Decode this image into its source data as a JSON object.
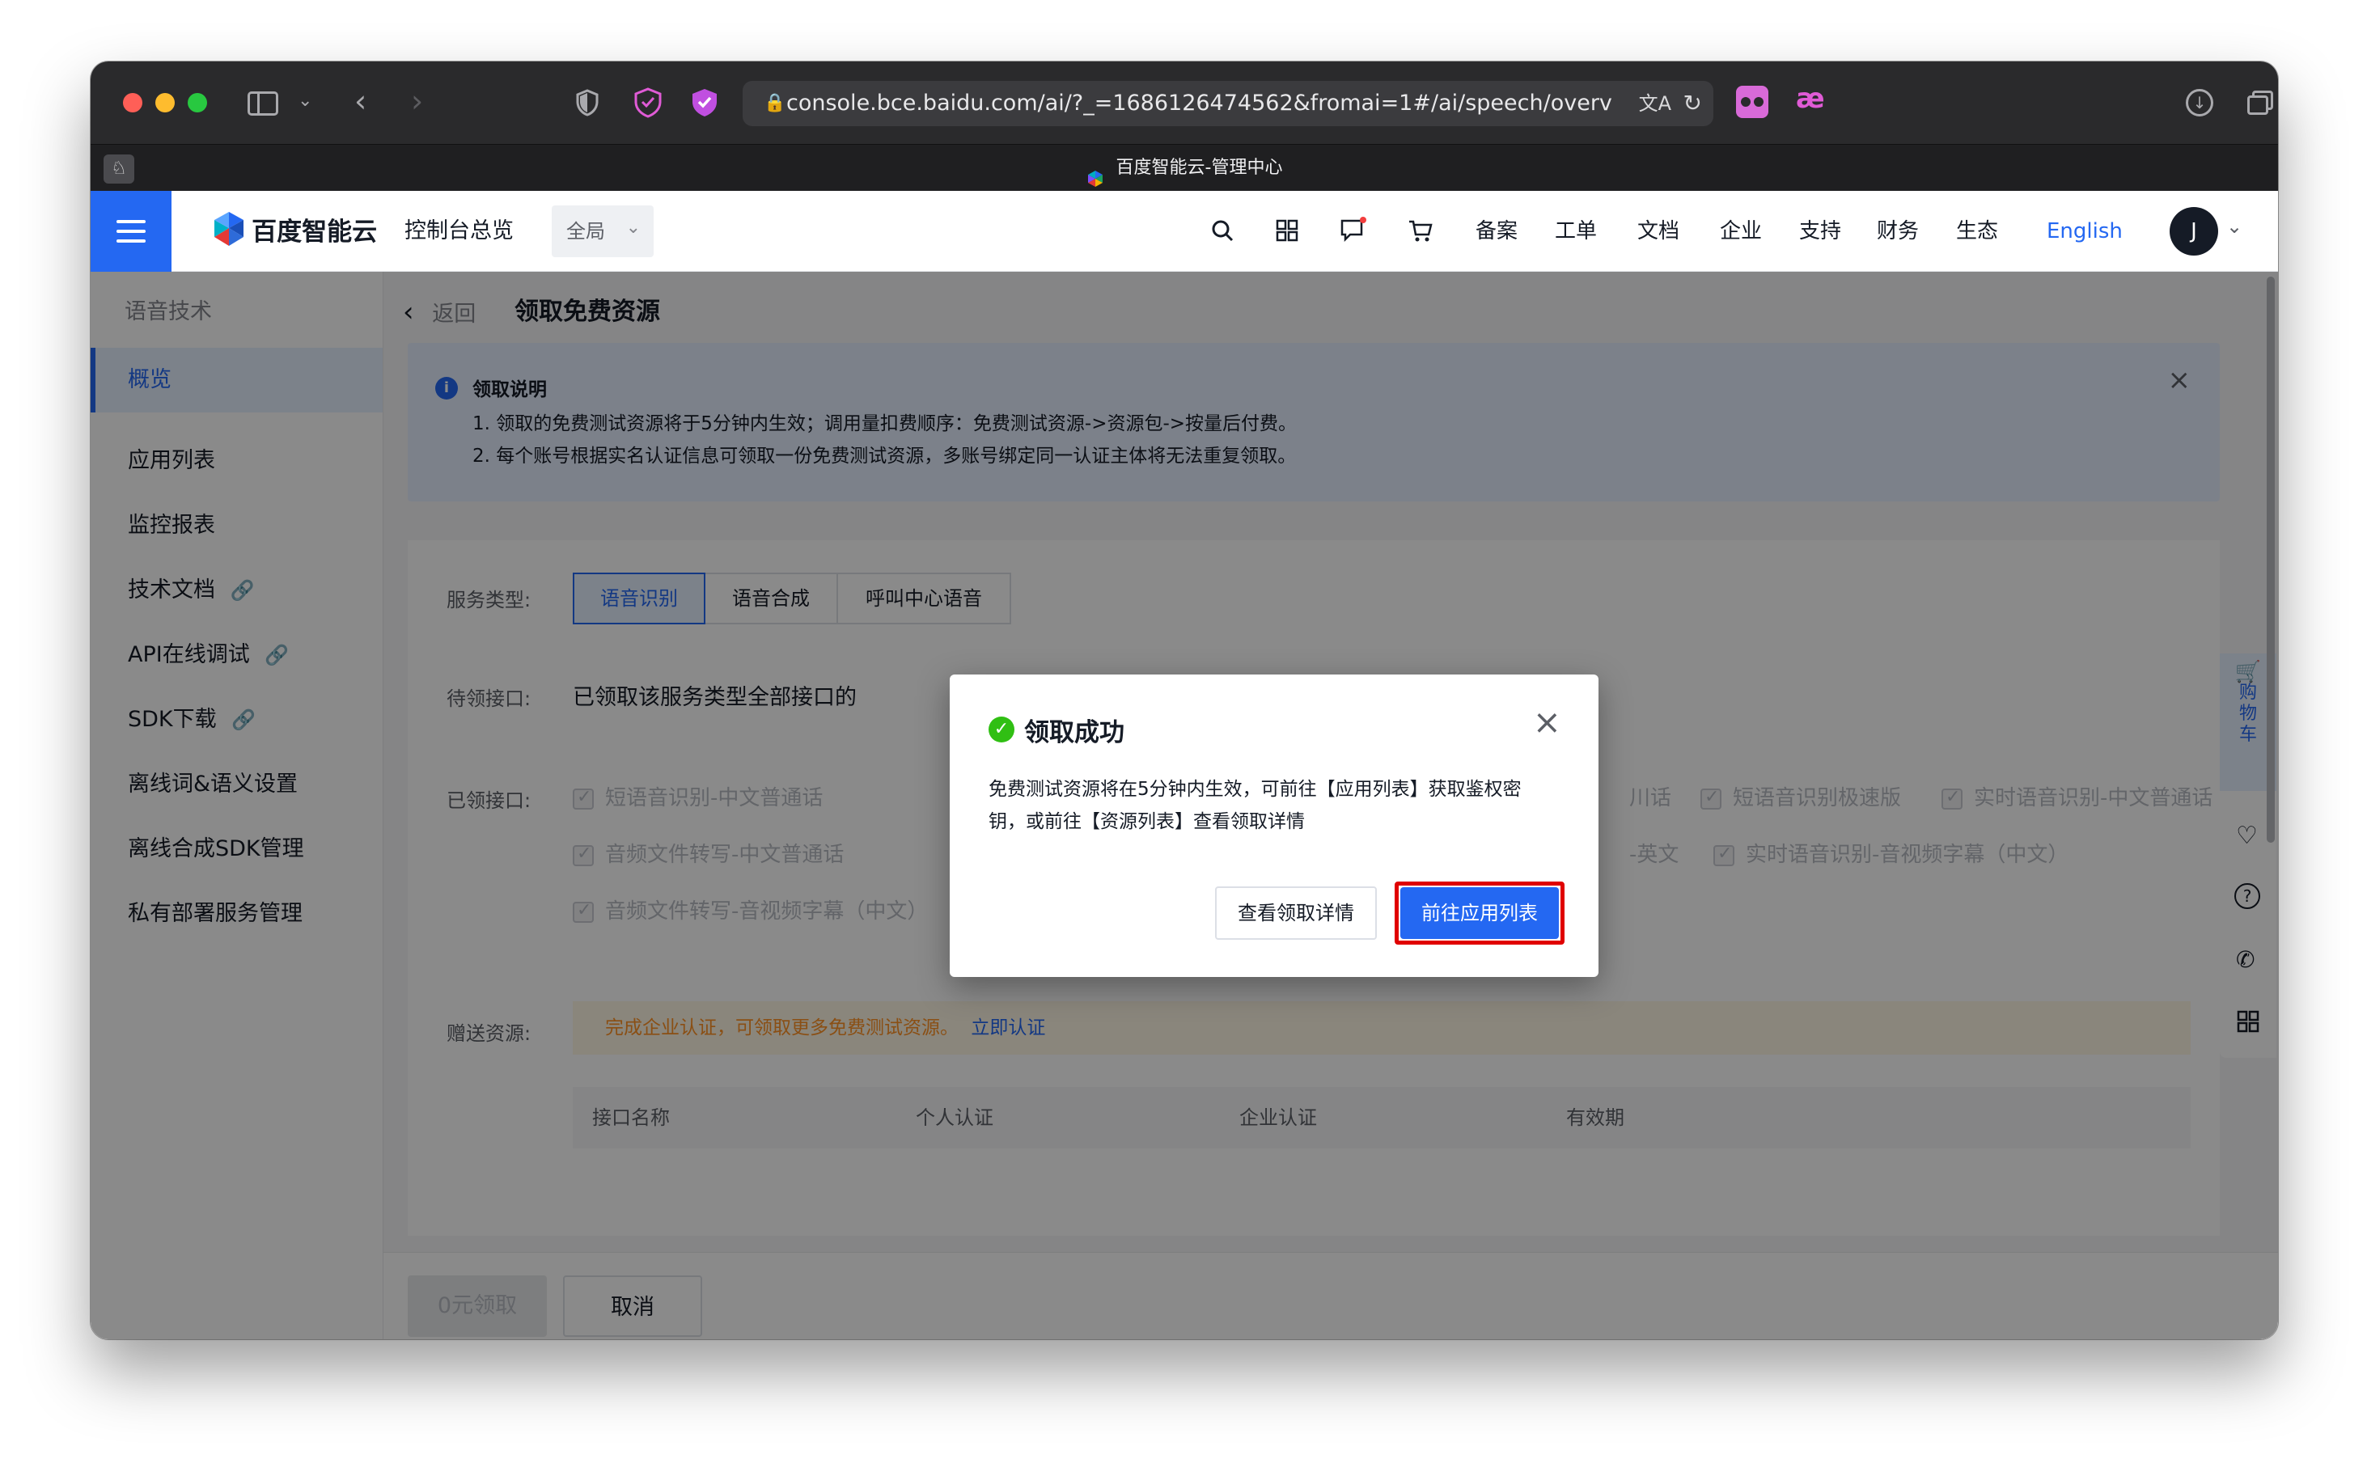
{
  "browser": {
    "url": "console.bce.baidu.com/ai/?_=1686126474562&fromai=1#/ai/speech/overv",
    "tab_title": "百度智能云-管理中心",
    "traffic_lights": [
      "#ff5f57",
      "#febc2e",
      "#28c840"
    ]
  },
  "header": {
    "logo_text": "百度智能云",
    "console_overview": "控制台总览",
    "region": "全局",
    "nav_links": [
      "备案",
      "工单",
      "文档",
      "企业",
      "支持",
      "财务",
      "生态"
    ],
    "language": "English",
    "avatar": "J"
  },
  "sidebar": {
    "title": "语音技术",
    "items": [
      {
        "label": "概览"
      },
      {
        "label": "应用列表"
      },
      {
        "label": "监控报表"
      },
      {
        "label": "技术文档"
      },
      {
        "label": "API在线调试"
      },
      {
        "label": "SDK下载"
      },
      {
        "label": "离线词&语义设置"
      },
      {
        "label": "离线合成SDK管理"
      },
      {
        "label": "私有部署服务管理"
      }
    ]
  },
  "page": {
    "back_label": "返回",
    "title": "领取免费资源",
    "notice": {
      "title": "领取说明",
      "line1": "1. 领取的免费测试资源将于5分钟内生效；调用量扣费顺序：免费测试资源->资源包->按量后付费。",
      "line2": "2. 每个账号根据实名认证信息可领取一份免费测试资源，多账号绑定同一认证主体将无法重复领取。"
    },
    "form": {
      "service_type_label": "服务类型:",
      "service_tabs": [
        "语音识别",
        "语音合成",
        "呼叫中心语音"
      ],
      "pending_label": "待领接口:",
      "pending_value": "已领取该服务类型全部接口的",
      "received_label": "已领接口:",
      "received_row1_left": "短语音识别-中文普通话",
      "received_row1_frag": "川话",
      "received_row1_b": "短语音识别极速版",
      "received_row1_c": "实时语音识别-中文普通话",
      "received_row2_left": "音频文件转写-中文普通话",
      "received_row2_frag": "-英文",
      "received_row2_b": "实时语音识别-音视频字幕（中文）",
      "received_row3_left": "音频文件转写-音视频字幕（中文）",
      "gift_label": "赠送资源:",
      "gift_notice": "完成企业认证，可领取更多免费测试资源。",
      "gift_link": "立即认证",
      "table_headers": [
        "接口名称",
        "个人认证",
        "企业认证",
        "有效期"
      ]
    },
    "footer": {
      "claim_button": "0元领取",
      "cancel_button": "取消"
    }
  },
  "float_bar": {
    "cart_label": "购物车"
  },
  "modal": {
    "title": "领取成功",
    "body_line1": "免费测试资源将在5分钟内生效，可前往【应用列表】获取鉴权密",
    "body_line2": "钥，或前往【资源列表】查看领取详情",
    "secondary_button": "查看领取详情",
    "primary_button": "前往应用列表",
    "success_color": "#30bf13",
    "highlight_color": "#e00000"
  },
  "colors": {
    "brand_blue": "#2468f2"
  }
}
